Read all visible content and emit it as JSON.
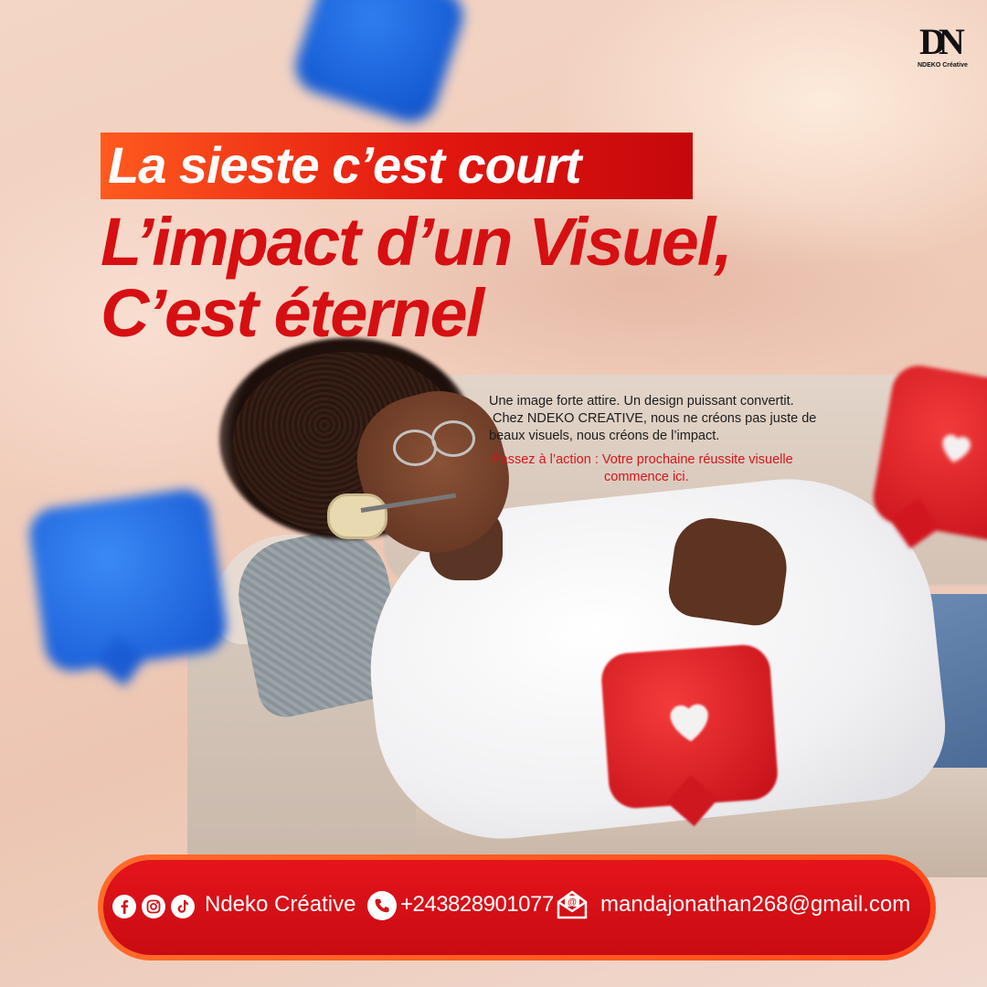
{
  "brand_logo": {
    "mark": "DN",
    "text": "NDEKO Créative"
  },
  "headline": {
    "tag": "La sieste c’est court",
    "line2": "L’impact d’un Visuel,",
    "line3": "C’est éternel"
  },
  "body": {
    "line1": "Une image forte attire. Un design puissant convertit.",
    "line2": "Chez NDEKO CREATIVE, nous ne créons pas juste de",
    "line3": "beaux visuels, nous créons de l’impact.",
    "cta_line1": "Passez à l’action : Votre prochaine réussite visuelle",
    "cta_line2": "commence ici."
  },
  "footer": {
    "social_icons": [
      "facebook-icon",
      "instagram-icon",
      "tiktok-icon"
    ],
    "brand_name": "Ndeko Créative",
    "phone": "+243828901077",
    "email": "mandajonathan268@gmail.com"
  },
  "colors": {
    "accent_red": "#d60f12",
    "accent_orange": "#ff5a1e",
    "background": "#f1cdbb",
    "text_dark": "#1c1c1c"
  }
}
